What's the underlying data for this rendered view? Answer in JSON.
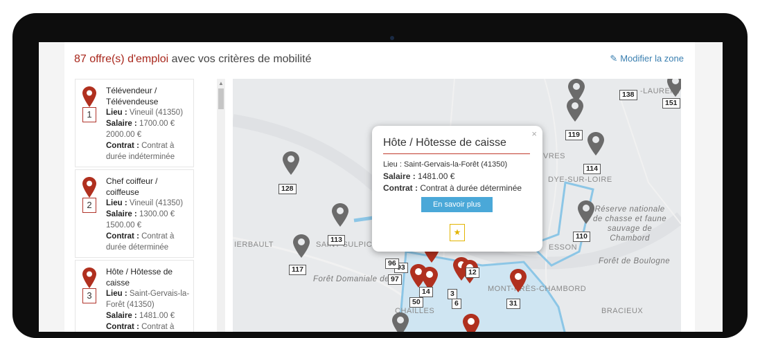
{
  "header": {
    "count_text": "87 offre(s) d'emploi",
    "rest_text": " avec vos critères de mobilité",
    "modify_label": "Modifier la zone"
  },
  "jobs": [
    {
      "number": "1",
      "title": "Télévendeur / Télévendeuse",
      "lieu_label": "Lieu : ",
      "lieu": "Vineuil (41350)",
      "salaire_label": "Salaire : ",
      "salaire": "1700.00 € 2000.00 €",
      "contrat_label": "Contrat : ",
      "contrat": "Contrat à durée indéterminée"
    },
    {
      "number": "2",
      "title": "Chef coiffeur / coiffeuse",
      "lieu_label": "Lieu : ",
      "lieu": "Vineuil (41350)",
      "salaire_label": "Salaire : ",
      "salaire": "1300.00 € 1500.00 €",
      "contrat_label": "Contrat : ",
      "contrat": "Contrat à durée déterminée"
    },
    {
      "number": "3",
      "title": "Hôte / Hôtesse de caisse",
      "lieu_label": "Lieu : ",
      "lieu": "Saint-Gervais-la-Forêt (41350)",
      "salaire_label": "Salaire : ",
      "salaire": "1481.00 €",
      "contrat_label": "Contrat : ",
      "contrat": "Contrat à"
    }
  ],
  "popup": {
    "close": "×",
    "title": "Hôte / Hôtesse de caisse",
    "lieu": "Lieu : Saint-Gervais-la-Forêt (41350)",
    "salaire_label": "Salaire : ",
    "salaire": "1481.00 €",
    "contrat_label": "Contrat : ",
    "contrat": "Contrat à durée déterminée",
    "button": "En savoir plus",
    "star": "★"
  },
  "map": {
    "places": {
      "st_laurent": "-LAURENT-N",
      "vres": "VRES",
      "dye_sur_loire": "DYE-SUR-LOIRE",
      "reserve": "Réserve nationale\nde chasse et faune\nsauvage de\nChambord",
      "foret_boulogne": "Forêt de Boulogne",
      "ierbault": "IERBAULT",
      "st_sulpice": "SAINT-SULPICE-D",
      "foret_domaniale": "Forêt Domaniale de B",
      "mont_pres": "MONT-PRÈS-CHAMBORD",
      "bracieux": "BRACIEUX",
      "chailles": "CHAILLES",
      "esson": "ESSON"
    },
    "tags": [
      "138",
      "151",
      "119",
      "128",
      "114",
      "113",
      "110",
      "117",
      "97",
      "50",
      "14",
      "31",
      "3",
      "6",
      "12",
      "93",
      "96"
    ],
    "colors": {
      "red_pin": "#b0301f",
      "grey_pin": "#6b6b6b",
      "zone": "#8cc6e6"
    }
  }
}
